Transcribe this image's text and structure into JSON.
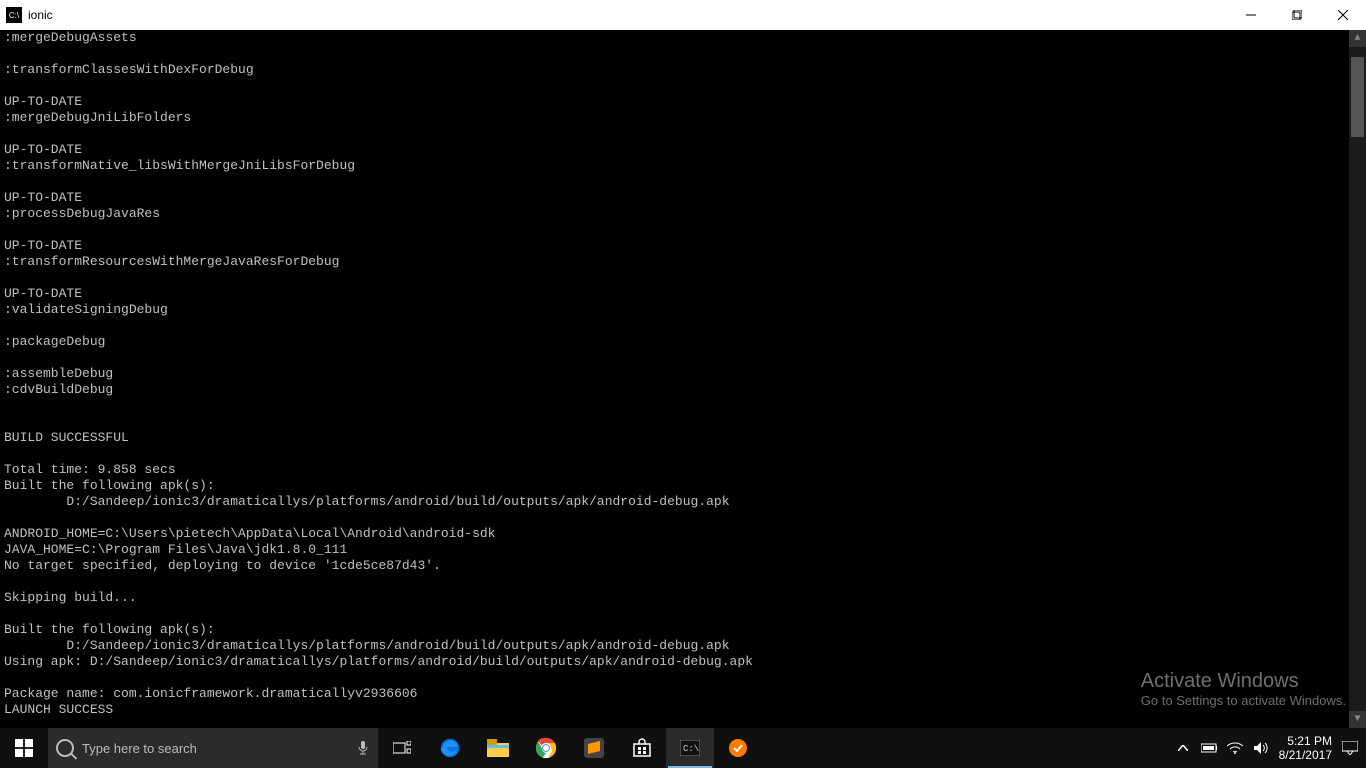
{
  "window": {
    "title": "ionic"
  },
  "terminal": {
    "lines": [
      ":mergeDebugAssets",
      "",
      ":transformClassesWithDexForDebug",
      "",
      "UP-TO-DATE",
      ":mergeDebugJniLibFolders",
      "",
      "UP-TO-DATE",
      ":transformNative_libsWithMergeJniLibsForDebug",
      "",
      "UP-TO-DATE",
      ":processDebugJavaRes",
      "",
      "UP-TO-DATE",
      ":transformResourcesWithMergeJavaResForDebug",
      "",
      "UP-TO-DATE",
      ":validateSigningDebug",
      "",
      ":packageDebug",
      "",
      ":assembleDebug",
      ":cdvBuildDebug",
      "",
      "",
      "BUILD SUCCESSFUL",
      "",
      "Total time: 9.858 secs",
      "Built the following apk(s):",
      "        D:/Sandeep/ionic3/dramaticallys/platforms/android/build/outputs/apk/android-debug.apk",
      "",
      "ANDROID_HOME=C:\\Users\\pietech\\AppData\\Local\\Android\\android-sdk",
      "JAVA_HOME=C:\\Program Files\\Java\\jdk1.8.0_111",
      "No target specified, deploying to device '1cde5ce87d43'.",
      "",
      "Skipping build...",
      "",
      "Built the following apk(s):",
      "        D:/Sandeep/ionic3/dramaticallys/platforms/android/build/outputs/apk/android-debug.apk",
      "Using apk: D:/Sandeep/ionic3/dramaticallys/platforms/android/build/outputs/apk/android-debug.apk",
      "",
      "Package name: com.ionicframework.dramaticallyv2936606",
      "LAUNCH SUCCESS"
    ]
  },
  "watermark": {
    "title": "Activate Windows",
    "subtitle": "Go to Settings to activate Windows."
  },
  "taskbar": {
    "search_placeholder": "Type here to search",
    "time": "5:21 PM",
    "date": "8/21/2017"
  }
}
